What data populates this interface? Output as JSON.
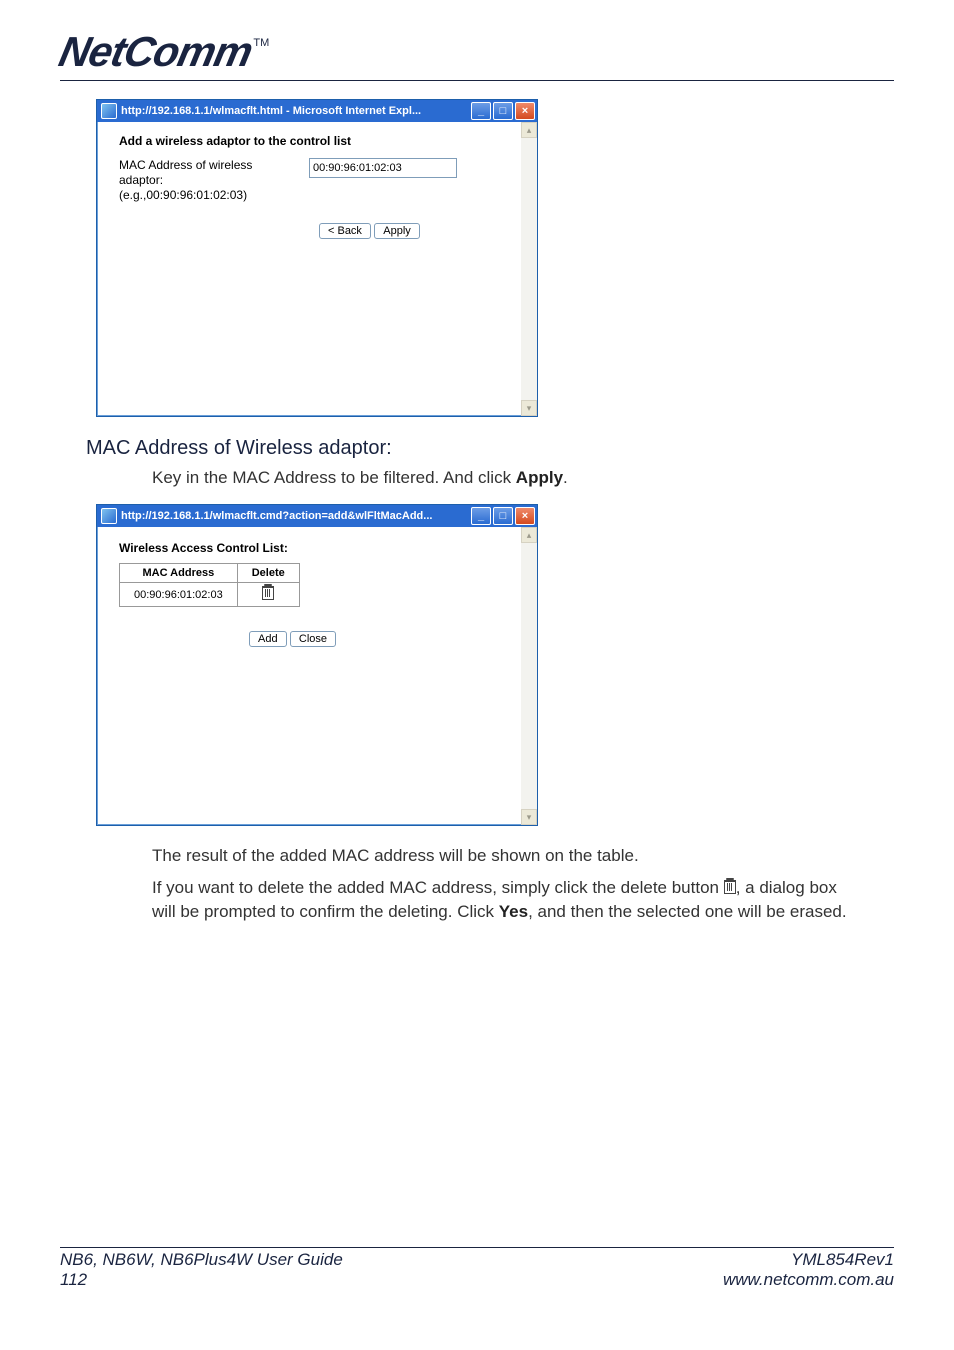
{
  "logo": {
    "text": "NetComm",
    "tm": "TM"
  },
  "window1": {
    "title": "http://192.168.1.1/wlmacflt.html - Microsoft Internet Expl...",
    "heading": "Add a wireless adaptor to the control list",
    "label_line1": "MAC Address of wireless",
    "label_line2": "adaptor:",
    "label_line3": "(e.g.,00:90:96:01:02:03)",
    "input_value": "00:90:96:01:02:03",
    "back": "< Back",
    "apply": "Apply"
  },
  "section1": {
    "heading": "MAC Address of Wireless adaptor:",
    "line": "Key in the MAC Address to be filtered. And click ",
    "apply_word": "Apply",
    "period": "."
  },
  "window2": {
    "title": "http://192.168.1.1/wlmacflt.cmd?action=add&wlFltMacAdd...",
    "heading": "Wireless Access Control List:",
    "col1": "MAC Address",
    "col2": "Delete",
    "cell": "00:90:96:01:02:03",
    "add": "Add",
    "close": "Close"
  },
  "para1": "The result of the added MAC address will be shown on the table.",
  "para2_a": "If you want to delete the added MAC address, simply click the delete button ",
  "para2_b": ", a dialog box will be prompted to confirm the deleting. Click ",
  "para2_yes": "Yes",
  "para2_c": ", and then the selected one will be erased.",
  "footer": {
    "left1": "NB6, NB6W, NB6Plus4W User Guide",
    "left2": "112",
    "right1": "YML854Rev1",
    "right2": "www.netcomm.com.au"
  }
}
